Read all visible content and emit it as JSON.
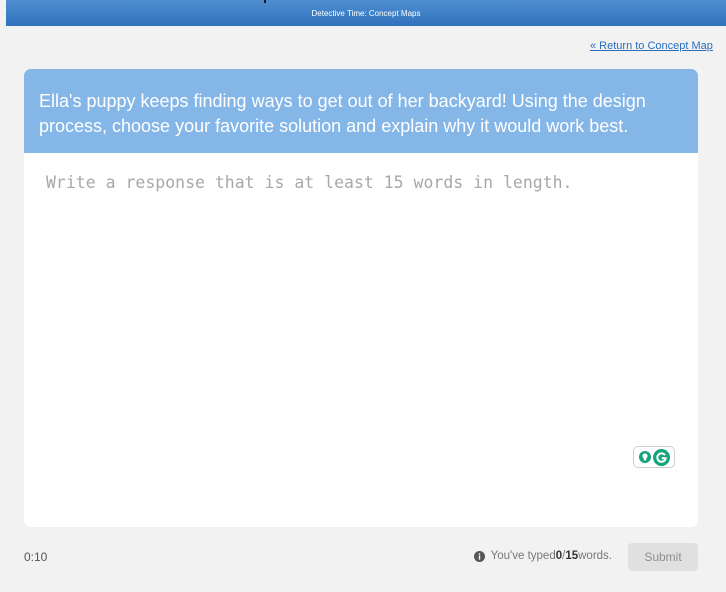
{
  "header": {
    "title": "Detective Time: Concept Maps"
  },
  "nav": {
    "return_link": "« Return to Concept Map"
  },
  "question": {
    "prompt": "Ella's puppy keeps finding ways to get out of her backyard! Using the design process, choose your favorite solution and explain why it would work best."
  },
  "response": {
    "value": "",
    "placeholder": "Write a response that is at least 15 words in length."
  },
  "footer": {
    "timer": "0:10",
    "typed_prefix": "You've typed ",
    "typed_count": "0",
    "typed_separator": " / ",
    "min_words": "15",
    "typed_suffix": " words.",
    "submit_label": "Submit"
  },
  "icons": {
    "info": "info-icon",
    "grammarly_bulb": "lightbulb-icon",
    "grammarly_logo": "grammarly-g-icon"
  },
  "colors": {
    "header_blue": "#3a7fc6",
    "prompt_blue": "#84b6e8",
    "link_blue": "#2a6ebb",
    "grammarly_green": "#15a57a"
  }
}
